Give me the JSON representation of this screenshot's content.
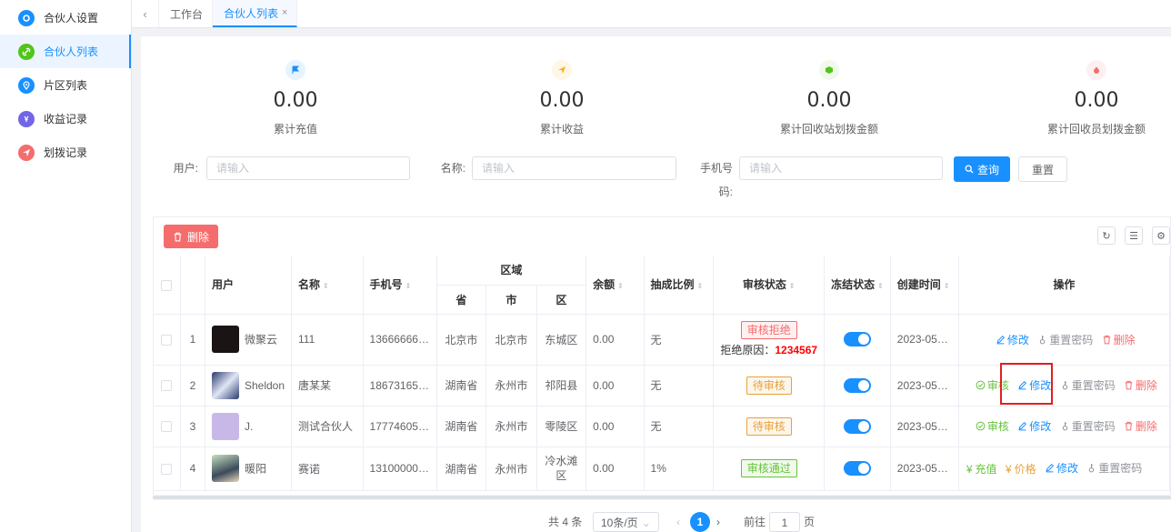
{
  "sidebar": {
    "items": [
      {
        "label": "合伙人设置",
        "icon": "settings-icon",
        "color": "#1890ff"
      },
      {
        "label": "合伙人列表",
        "icon": "link-icon",
        "color": "#52c41a"
      },
      {
        "label": "片区列表",
        "icon": "location-icon",
        "color": "#1890ff"
      },
      {
        "label": "收益记录",
        "icon": "yen-icon",
        "color": "#7265e6"
      },
      {
        "label": "划拨记录",
        "icon": "send-icon",
        "color": "#f56c6c"
      }
    ]
  },
  "tabs": [
    {
      "label": "工作台"
    },
    {
      "label": "合伙人列表",
      "close": "×"
    }
  ],
  "stats": [
    {
      "value": "0.00",
      "label": "累计充值",
      "icon": "flag-icon",
      "color": "#1890ff"
    },
    {
      "value": "0.00",
      "label": "累计收益",
      "icon": "send-icon",
      "color": "#faad14"
    },
    {
      "value": "0.00",
      "label": "累计回收站划拨金额",
      "icon": "cube-icon",
      "color": "#52c41a"
    },
    {
      "value": "0.00",
      "label": "累计回收员划拨金额",
      "icon": "money-bag-icon",
      "color": "#f56c6c"
    }
  ],
  "filters": {
    "user_label": "用户:",
    "name_label": "名称:",
    "phone_label": "手机号码:",
    "placeholder": "请输入",
    "search_label": "查询",
    "reset_label": "重置"
  },
  "toolbar": {
    "delete_label": "删除"
  },
  "table": {
    "headers": {
      "user": "用户",
      "name": "名称",
      "phone": "手机号",
      "region": "区域",
      "province": "省",
      "city": "市",
      "district": "区",
      "balance": "余额",
      "ratio": "抽成比例",
      "audit": "审核状态",
      "freeze": "冻结状态",
      "created": "创建时间",
      "ops": "操作"
    },
    "rows": [
      {
        "index": "1",
        "user": "微聚云",
        "name": "111",
        "phone": "13666666…",
        "province": "北京市",
        "city": "北京市",
        "district": "东城区",
        "balance": "0.00",
        "ratio": "无",
        "audit": "审核拒绝",
        "audit_type": "danger",
        "reason_label": "拒绝原因：",
        "reason_value": "1234567",
        "created": "2023-05…",
        "ops": [
          {
            "label": "修改",
            "type": "edit"
          },
          {
            "label": "重置密码",
            "type": "reset"
          },
          {
            "label": "删除",
            "type": "delete"
          }
        ]
      },
      {
        "index": "2",
        "user": "Sheldon",
        "name": "唐某某",
        "phone": "18673165…",
        "province": "湖南省",
        "city": "永州市",
        "district": "祁阳县",
        "balance": "0.00",
        "ratio": "无",
        "audit": "待审核",
        "audit_type": "warning",
        "created": "2023-05…",
        "ops": [
          {
            "label": "审核",
            "type": "audit"
          },
          {
            "label": "修改",
            "type": "edit"
          },
          {
            "label": "重置密码",
            "type": "reset"
          },
          {
            "label": "删除",
            "type": "delete"
          }
        ]
      },
      {
        "index": "3",
        "user": "J.",
        "name": "测试合伙人",
        "phone": "17774605…",
        "province": "湖南省",
        "city": "永州市",
        "district": "零陵区",
        "balance": "0.00",
        "ratio": "无",
        "audit": "待审核",
        "audit_type": "warning",
        "created": "2023-05…",
        "ops": [
          {
            "label": "审核",
            "type": "audit"
          },
          {
            "label": "修改",
            "type": "edit"
          },
          {
            "label": "重置密码",
            "type": "reset"
          },
          {
            "label": "删除",
            "type": "delete"
          }
        ]
      },
      {
        "index": "4",
        "user": "暖阳",
        "name": "赛诺",
        "phone": "13100000…",
        "province": "湖南省",
        "city": "永州市",
        "district": "冷水滩区",
        "balance": "0.00",
        "ratio": "1%",
        "audit": "审核通过",
        "audit_type": "success",
        "created": "2023-05…",
        "ops": [
          {
            "label": "充值",
            "type": "recharge"
          },
          {
            "label": "价格",
            "type": "price"
          },
          {
            "label": "修改",
            "type": "edit"
          },
          {
            "label": "重置密码",
            "type": "reset"
          }
        ]
      }
    ]
  },
  "pagination": {
    "total": "共 4 条",
    "page_size": "10条/页",
    "current": "1",
    "goto_label": "前往",
    "goto_value": "1",
    "page_suffix": "页"
  }
}
